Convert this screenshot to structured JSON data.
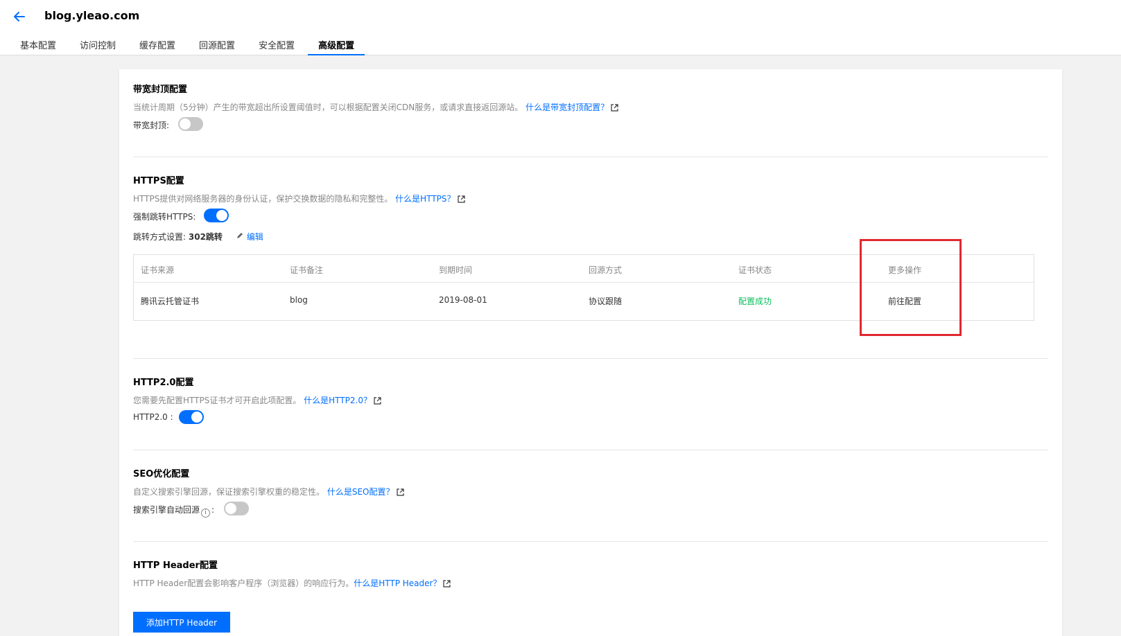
{
  "header": {
    "domain": "blog.yleao.com",
    "back_icon": "arrow-left-icon"
  },
  "tabs": [
    {
      "label": "基本配置"
    },
    {
      "label": "访问控制"
    },
    {
      "label": "缓存配置"
    },
    {
      "label": "回源配置"
    },
    {
      "label": "安全配置"
    },
    {
      "label": "高级配置",
      "active": true
    }
  ],
  "bandwidth": {
    "title": "带宽封顶配置",
    "desc": "当统计周期（5分钟）产生的带宽超出所设置阈值时，可以根据配置关闭CDN服务，或请求直接返回源站。",
    "link": "什么是带宽封顶配置？",
    "toggle_label": "带宽封顶:",
    "toggle_on": false
  },
  "https": {
    "title": "HTTPS配置",
    "desc": "HTTPS提供对网络服务器的身份认证，保护交换数据的隐私和完整性。",
    "link": "什么是HTTPS？",
    "force_label": "强制跳转HTTPS:",
    "force_on": true,
    "redirect_label": "跳转方式设置:",
    "redirect_value": "302跳转",
    "edit_label": "编辑",
    "table": {
      "headers": [
        "证书来源",
        "证书备注",
        "到期时间",
        "回源方式",
        "证书状态",
        "更多操作"
      ],
      "row": [
        "腾讯云托管证书",
        "blog",
        "2019-08-01",
        "协议跟随",
        "配置成功",
        "前往配置"
      ],
      "status_color": "#0abf5b"
    }
  },
  "http2": {
    "title": "HTTP2.0配置",
    "desc": "您需要先配置HTTPS证书才可开启此项配置。",
    "link": "什么是HTTP2.0？",
    "toggle_label": "HTTP2.0 :",
    "toggle_on": true
  },
  "seo": {
    "title": "SEO优化配置",
    "desc": "自定义搜索引擎回源，保证搜索引擎权重的稳定性。",
    "link": "什么是SEO配置？",
    "toggle_label_pre": "搜索引擎自动回源",
    "toggle_label_post": ":",
    "toggle_on": false
  },
  "header_cfg": {
    "title": "HTTP Header配置",
    "desc": "HTTP Header配置会影响客户程序（浏览器）的响应行为。",
    "link": "什么是HTTP Header？",
    "button": "添加HTTP Header"
  },
  "colors": {
    "accent": "#006eff",
    "success": "#0abf5b",
    "highlight": "#e0282e"
  }
}
